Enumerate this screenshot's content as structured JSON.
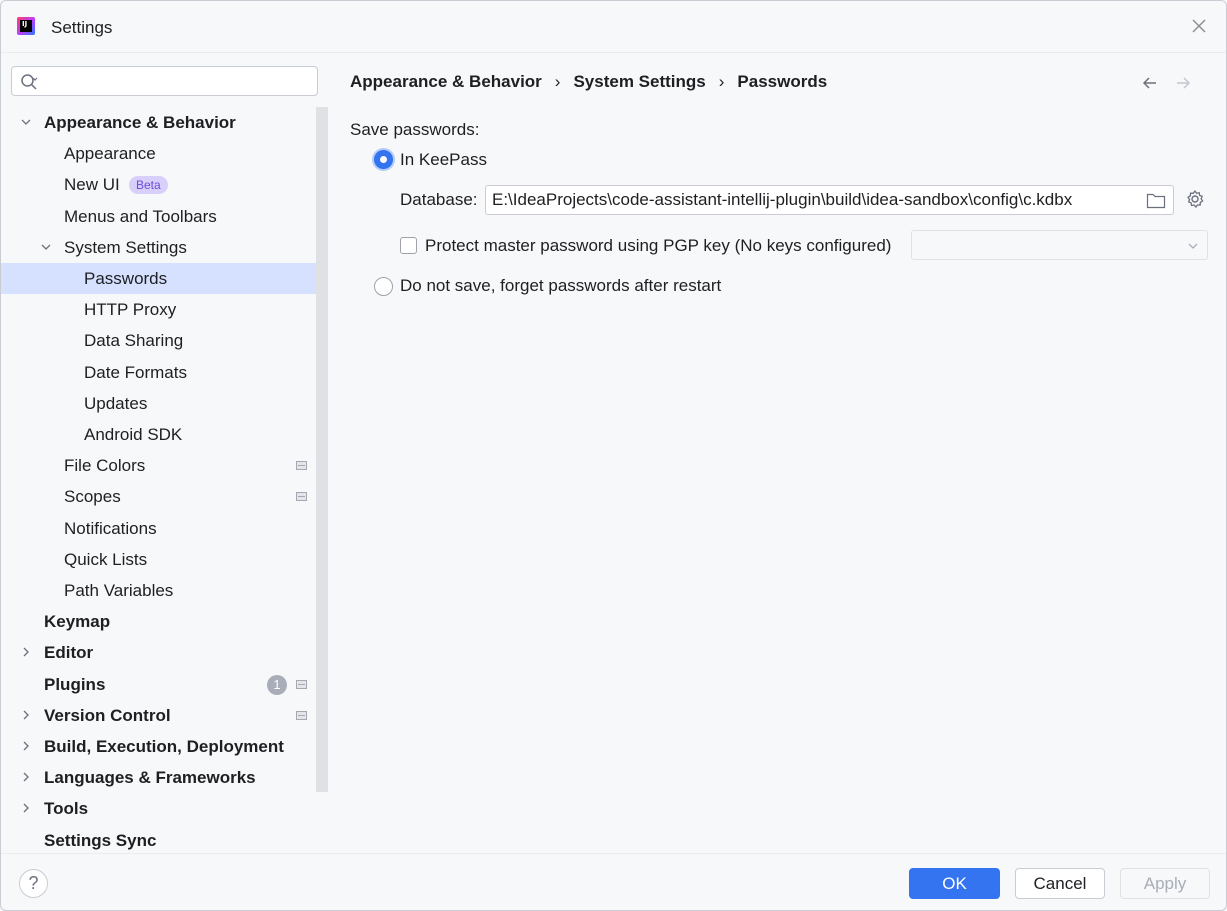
{
  "window": {
    "title": "Settings",
    "app_icon": "intellij-idea-icon"
  },
  "search": {
    "placeholder": "",
    "value": ""
  },
  "sidebar": {
    "items": [
      {
        "label": "Appearance & Behavior",
        "level": 0,
        "bold": true,
        "expandable": true,
        "expanded": true
      },
      {
        "label": "Appearance",
        "level": 1
      },
      {
        "label": "New UI",
        "level": 1,
        "badge": "Beta"
      },
      {
        "label": "Menus and Toolbars",
        "level": 1
      },
      {
        "label": "System Settings",
        "level": 1,
        "expandable": true,
        "expanded": true
      },
      {
        "label": "Passwords",
        "level": 2,
        "selected": true
      },
      {
        "label": "HTTP Proxy",
        "level": 2
      },
      {
        "label": "Data Sharing",
        "level": 2
      },
      {
        "label": "Date Formats",
        "level": 2
      },
      {
        "label": "Updates",
        "level": 2
      },
      {
        "label": "Android SDK",
        "level": 2
      },
      {
        "label": "File Colors",
        "level": 1,
        "project_icon": true
      },
      {
        "label": "Scopes",
        "level": 1,
        "project_icon": true
      },
      {
        "label": "Notifications",
        "level": 1
      },
      {
        "label": "Quick Lists",
        "level": 1
      },
      {
        "label": "Path Variables",
        "level": 1
      },
      {
        "label": "Keymap",
        "level": 0,
        "bold": true
      },
      {
        "label": "Editor",
        "level": 0,
        "bold": true,
        "expandable": true
      },
      {
        "label": "Plugins",
        "level": 0,
        "bold": true,
        "count": "1",
        "project_icon": true
      },
      {
        "label": "Version Control",
        "level": 0,
        "bold": true,
        "expandable": true,
        "project_icon": true
      },
      {
        "label": "Build, Execution, Deployment",
        "level": 0,
        "bold": true,
        "expandable": true
      },
      {
        "label": "Languages & Frameworks",
        "level": 0,
        "bold": true,
        "expandable": true
      },
      {
        "label": "Tools",
        "level": 0,
        "bold": true,
        "expandable": true
      },
      {
        "label": "Settings Sync",
        "level": 0,
        "bold": true
      }
    ]
  },
  "breadcrumb": {
    "items": [
      "Appearance & Behavior",
      "System Settings",
      "Passwords"
    ],
    "separator": "›"
  },
  "nav": {
    "back_icon": "arrow-left-icon",
    "forward_icon": "arrow-right-icon"
  },
  "passwords": {
    "section_label": "Save passwords:",
    "option_keepass": "In KeePass",
    "option_keepass_selected": true,
    "database_label": "Database:",
    "database_value": "E:\\IdeaProjects\\code-assistant-intellij-plugin\\build\\idea-sandbox\\config\\c.kdbx",
    "protect_label": "Protect master password using PGP key (No keys configured)",
    "protect_checked": false,
    "pgp_select_value": "",
    "option_do_not_save": "Do not save, forget passwords after restart"
  },
  "footer": {
    "help_label": "?",
    "ok_label": "OK",
    "cancel_label": "Cancel",
    "apply_label": "Apply"
  },
  "colors": {
    "accent": "#3574f0",
    "selection": "#d5e1ff",
    "badge_beta_bg": "#d8cffb",
    "badge_beta_fg": "#6e4bd9"
  }
}
